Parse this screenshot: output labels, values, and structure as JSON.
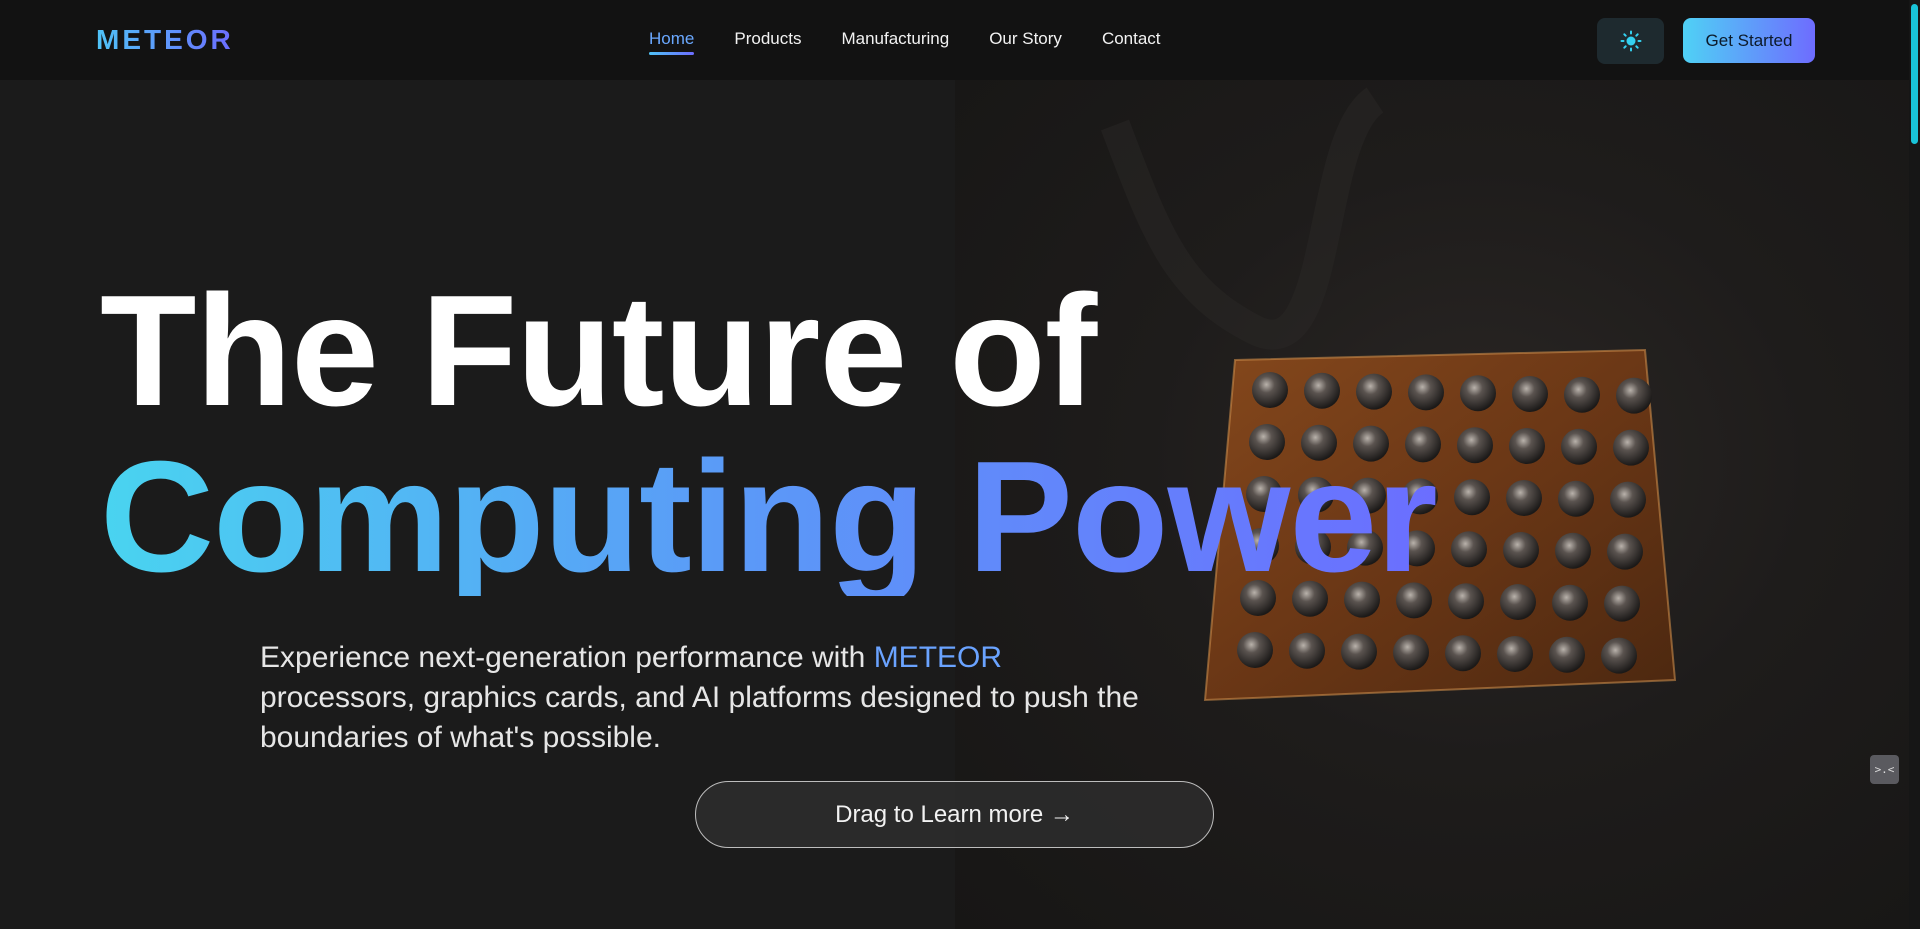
{
  "header": {
    "logo": "METEOR",
    "nav": [
      {
        "label": "Home",
        "active": true
      },
      {
        "label": "Products",
        "active": false
      },
      {
        "label": "Manufacturing",
        "active": false
      },
      {
        "label": "Our Story",
        "active": false
      },
      {
        "label": "Contact",
        "active": false
      }
    ],
    "theme_toggle_icon": "sun-icon",
    "cta_label": "Get Started"
  },
  "hero": {
    "title_line1": "The Future of",
    "title_line2": "Computing Power",
    "subtitle_pre": "Experience next-generation performance with",
    "subtitle_brand": "METEOR",
    "subtitle_post": "processors, graphics cards, and AI platforms designed to push the boundaries of what's possible.",
    "button_label": "Drag to Learn more →"
  },
  "widget": {
    "label": ">.<"
  },
  "colors": {
    "accent_start": "#4fd1f5",
    "accent_end": "#6c6cff",
    "background": "#161616"
  }
}
